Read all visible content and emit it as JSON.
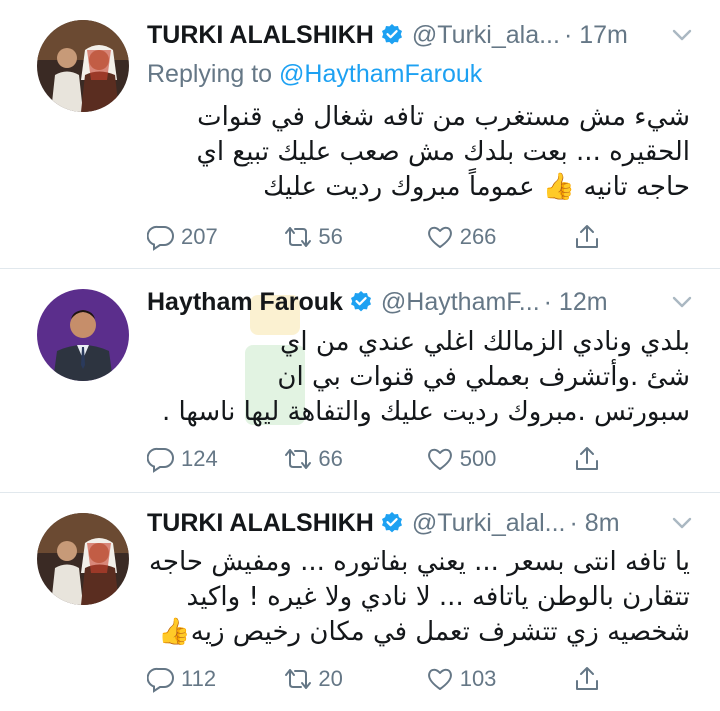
{
  "tweets": [
    {
      "name": "TURKI ALALSHIKH",
      "handle": "@Turki_ala...",
      "time": "· 17m",
      "replying_label": "Replying to",
      "replying_to": "@HaythamFarouk",
      "lines": [
        "شيء مش مستغرب من تافه شغال في قنوات",
        "الحقيره ... بعت بلدك مش صعب عليك تبيع اي",
        "حاجه تانيه 👍 عموماً مبروك رديت عليك"
      ],
      "replies": "207",
      "retweets": "56",
      "likes": "266"
    },
    {
      "name": "Haytham Farouk",
      "handle": "@HaythamF...",
      "time": "· 12m",
      "lines": [
        "بلدي ونادي الزمالك اغلي عندي من اي",
        "شئ .وأتشرف بعملي في قنوات بي ان",
        "سبورتس .مبروك رديت عليك والتفاهة ليها ناسها ."
      ],
      "replies": "124",
      "retweets": "66",
      "likes": "500"
    },
    {
      "name": "TURKI ALALSHIKH",
      "handle": "@Turki_alal...",
      "time": "· 8m",
      "lines": [
        "يا تافه انتى بسعر ... يعني بفاتوره ... ومفيش حاجه",
        "تتقارن بالوطن ياتافه ... لا نادي ولا غيره ! واكيد",
        "شخصيه زي تتشرف تعمل في مكان رخيص زيه👍"
      ],
      "replies": "112",
      "retweets": "20",
      "likes": "103"
    }
  ],
  "colors": {
    "verified": "#1da1f2",
    "mention": "#1da1f2",
    "muted": "#657786",
    "divider": "#e1e8ed"
  },
  "icons": [
    "verified-badge-icon",
    "chevron-down-icon",
    "reply-icon",
    "retweet-icon",
    "like-icon",
    "share-icon"
  ]
}
